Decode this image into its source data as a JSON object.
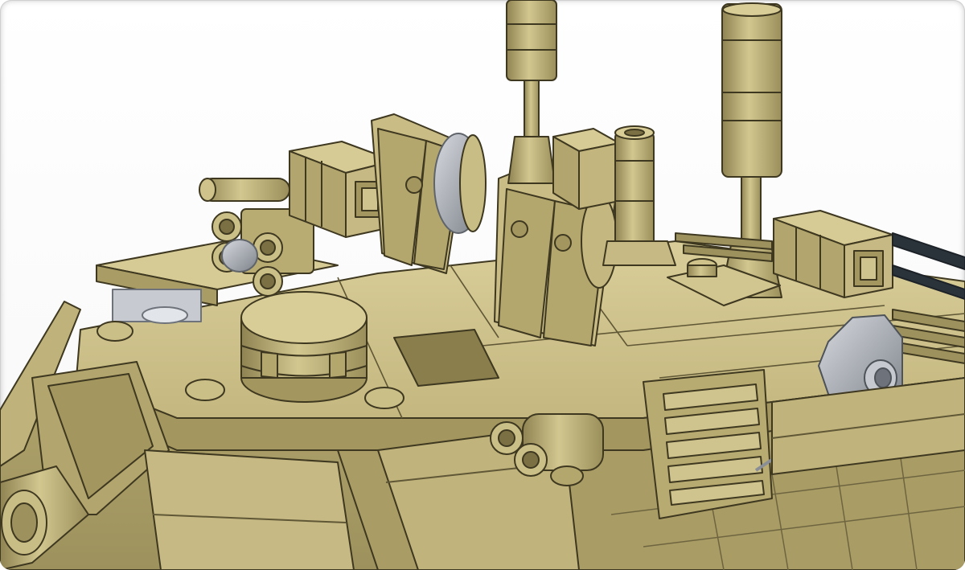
{
  "scene": {
    "subject": "",
    "colors": {
      "tan": "#b5a870",
      "tan_light": "#cdc08a",
      "tan_lighter": "#d9cd99",
      "tan_dark": "#8f8352",
      "outline": "#3e3820",
      "grey": "#a9aeb6",
      "grey_dark": "#6e737b",
      "rail": "#2a333a",
      "background": "#ffffff"
    }
  }
}
